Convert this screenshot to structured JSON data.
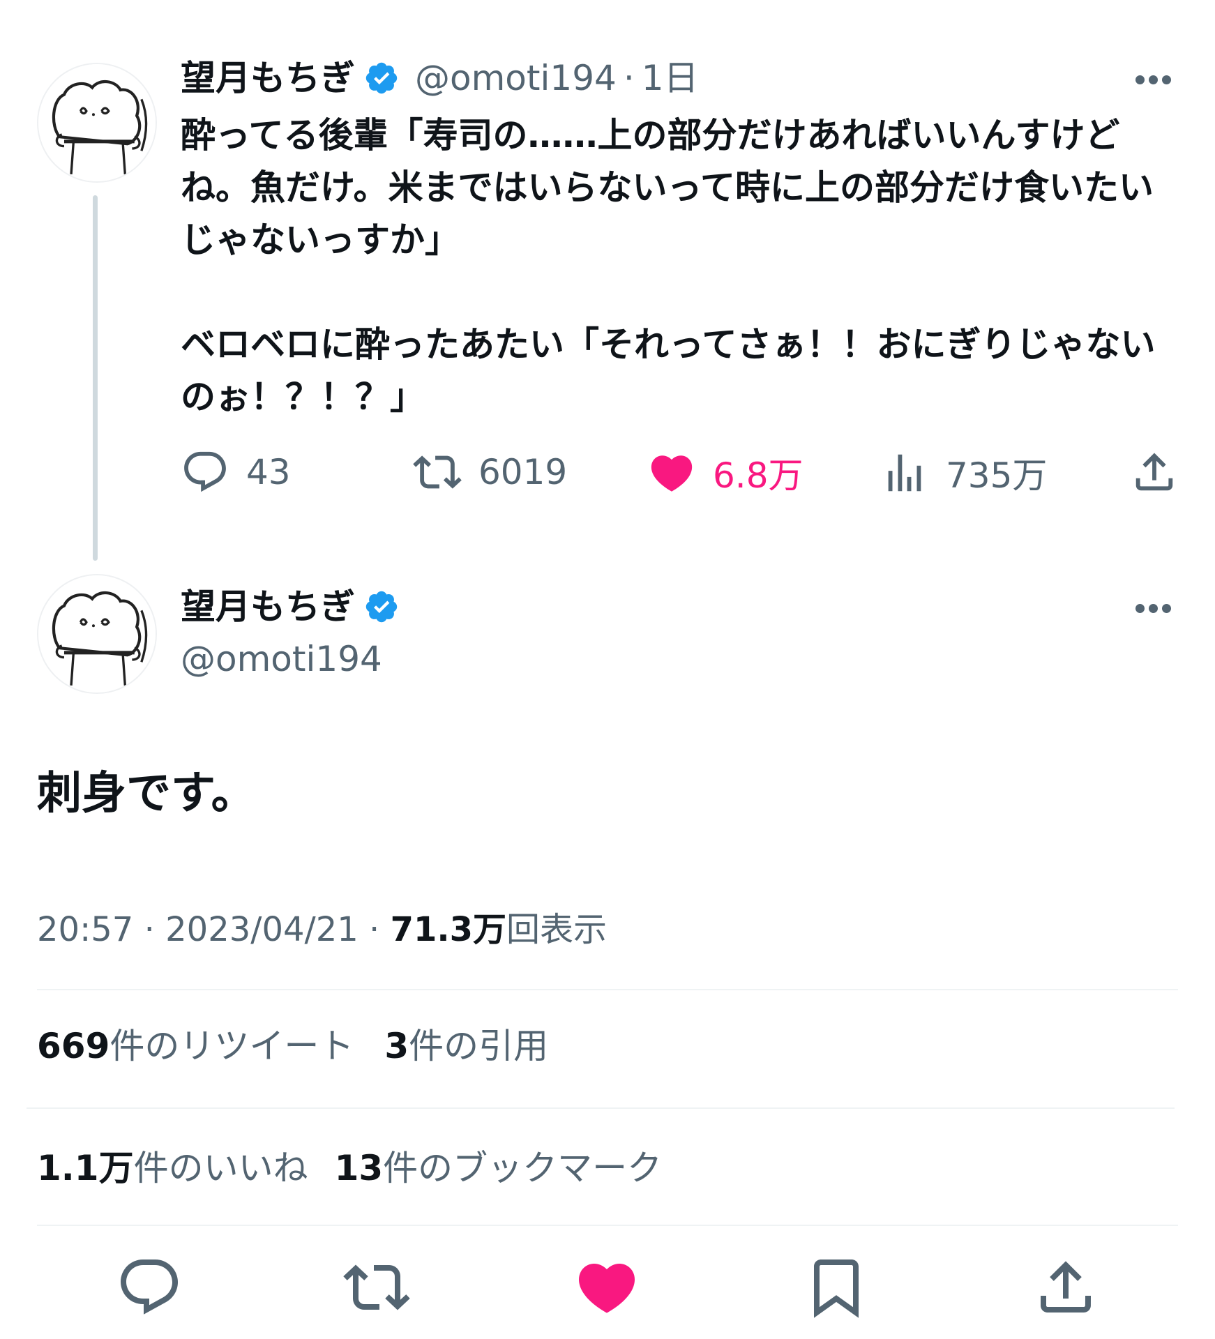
{
  "parent_tweet": {
    "display_name": "望月もちぎ",
    "handle": "@omoti194",
    "age": "1日",
    "separator": "·",
    "text": "酔ってる後輩「寿司の……上の部分だけあればいいんすけどね。魚だけ。米まではいらないって時に上の部分だけ食いたいじゃないっすか」\n\nベロベロに酔ったあたい「それってさぁ！！おにぎりじゃないのぉ！？！？」",
    "replies": "43",
    "retweets": "6019",
    "likes": "6.8万",
    "views": "735万"
  },
  "main_tweet": {
    "display_name": "望月もちぎ",
    "handle": "@omoti194",
    "text": "刺身です。",
    "time": "20:57",
    "date": "2023/04/21",
    "separator": "·",
    "view_count": "71.3万",
    "view_label": "回表示",
    "retweet_count": "669",
    "retweet_label": "件のリツイート",
    "quote_count": "3",
    "quote_label": "件の引用",
    "like_count": "1.1万",
    "like_label": "件のいいね",
    "bookmark_count": "13",
    "bookmark_label": "件のブックマーク"
  },
  "colors": {
    "like": "#f91880",
    "verified": "#1d9bf0",
    "secondary_text": "#536471"
  },
  "icons": [
    "reply-icon",
    "retweet-icon",
    "heart-icon",
    "views-icon",
    "share-icon",
    "bookmark-icon",
    "verified-badge-icon",
    "more-icon"
  ]
}
